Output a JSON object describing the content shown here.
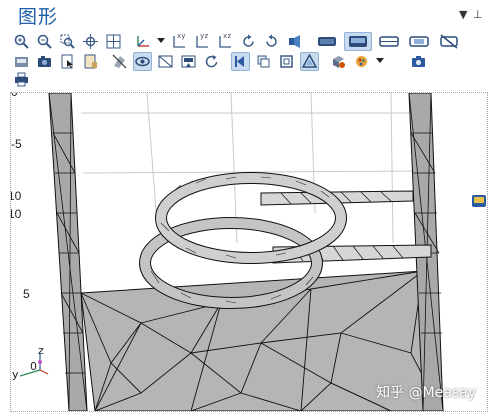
{
  "panel": {
    "title": "图形",
    "pin_glyph": "▼",
    "pin_icon": "dropdown-arrow-icon",
    "stick_glyph": "⊥"
  },
  "toolbar": {
    "view_labels": {
      "xy": "xy",
      "yz": "yz",
      "xz": "xz"
    },
    "row1_icons": [
      "zoom-in-icon",
      "zoom-out-icon",
      "zoom-box-icon",
      "zoom-extents-icon",
      "zoom-selection-icon",
      "axis-orientation-icon",
      "view-xy-icon",
      "view-yz-icon",
      "view-xz-icon",
      "rotate-cw-icon",
      "rotate-ccw-icon",
      "light-icon",
      "wireframe-icon",
      "surface-icon",
      "transparency-icon",
      "scene-light-icon",
      "hide-icon"
    ],
    "row2_icons": [
      "save-image-icon",
      "camera-icon",
      "select-icon",
      "clear-selection-icon",
      "hide-geometry-icon",
      "show-edges-icon",
      "show-grid-icon",
      "mesh-render-icon",
      "reset-view-icon",
      "select-domain-icon",
      "select-boundary-icon",
      "select-edge-icon",
      "select-point-icon",
      "color-table-icon",
      "render-options-icon",
      "screenshot-icon"
    ],
    "row3_icons": [
      "print-icon"
    ]
  },
  "viewport": {
    "y_tick_labels": [
      "0",
      "-5",
      "10",
      "10",
      "5"
    ],
    "triad": {
      "z": "z",
      "y": "y",
      "x_value": "0"
    },
    "watermark": "知乎 @Measay",
    "corner_icon": "theme-icon"
  },
  "colors": {
    "title": "#1f5fa8",
    "icon": "#3b5b88",
    "mesh_fill": "#b5b5b5",
    "mesh_line": "#111111",
    "coil_fill": "#cfcfcf"
  }
}
